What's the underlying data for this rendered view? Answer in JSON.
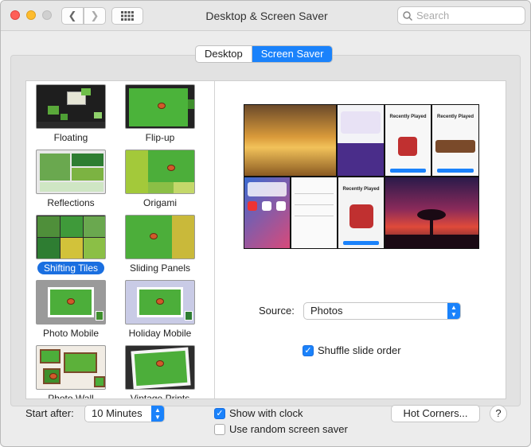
{
  "window": {
    "title": "Desktop & Screen Saver"
  },
  "search": {
    "placeholder": "Search"
  },
  "tabs": {
    "desktop": "Desktop",
    "screen_saver": "Screen Saver"
  },
  "savers": [
    {
      "label": "Floating"
    },
    {
      "label": "Flip-up"
    },
    {
      "label": "Reflections"
    },
    {
      "label": "Origami"
    },
    {
      "label": "Shifting Tiles",
      "selected": true
    },
    {
      "label": "Sliding Panels"
    },
    {
      "label": "Photo Mobile"
    },
    {
      "label": "Holiday Mobile"
    },
    {
      "label": "Photo Wall"
    },
    {
      "label": "Vintage Prints"
    }
  ],
  "preview": {
    "card_title_1": "Recently Played",
    "card_title_2": "Recently Played",
    "card_title_3": "Recently Played"
  },
  "source": {
    "label": "Source:",
    "value": "Photos"
  },
  "shuffle": {
    "label": "Shuffle slide order",
    "checked": true
  },
  "bottom": {
    "start_after_label": "Start after:",
    "start_after_value": "10 Minutes",
    "show_clock_label": "Show with clock",
    "show_clock_checked": true,
    "random_label": "Use random screen saver",
    "random_checked": false,
    "hot_corners": "Hot Corners...",
    "help": "?"
  },
  "colors": {
    "accent": "#1a82fb",
    "selection": "#1a6fe0"
  }
}
